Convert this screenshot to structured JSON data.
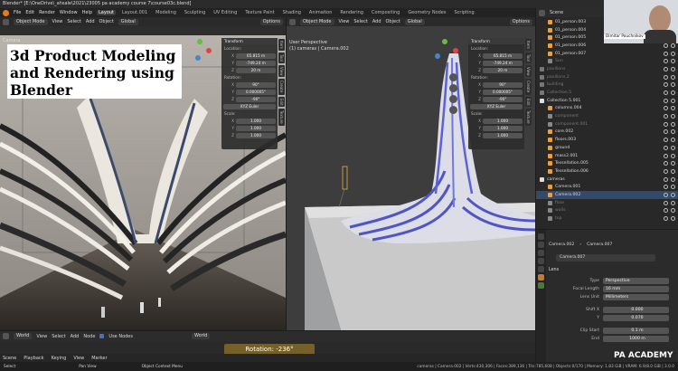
{
  "titlebar": {
    "text": "Blender* [E:\\OneDrive\\_ahsale\\2021\\23005 pa academy course 7\\course03c.blend]"
  },
  "menu": {
    "items": [
      "File",
      "Edit",
      "Render",
      "Window",
      "Help"
    ]
  },
  "workspaces": [
    "Layout",
    "Layout.001",
    "Modeling",
    "Sculpting",
    "UV Editing",
    "Texture Paint",
    "Shading",
    "Animation",
    "Rendering",
    "Compositing",
    "Geometry Nodes",
    "Scripting"
  ],
  "left_view": {
    "header": {
      "mode": "Object Mode",
      "menus": [
        "View",
        "Select",
        "Add",
        "Object"
      ],
      "orientation": "Global",
      "options": "Options"
    },
    "camera_label": "Camera",
    "overlay_title": "3d Product Modeling and Rendering using Blender",
    "npanel": {
      "title": "Transform",
      "location_label": "Location:",
      "location": [
        "65.815 m",
        "-749.24 m",
        "20 m"
      ],
      "rotation_label": "Rotation:",
      "rotation": [
        "90°",
        "0.000005°",
        "-90°"
      ],
      "rotation_mode": "XYZ Euler",
      "scale_label": "Scale:",
      "scale": [
        "1.000",
        "1.000",
        "1.000"
      ],
      "axes": [
        "X",
        "Y",
        "Z"
      ]
    },
    "tabs": [
      "Item",
      "Tool",
      "View",
      "Create",
      "Edit",
      "Texture"
    ]
  },
  "right_view": {
    "header": {
      "mode": "Object Mode",
      "menus": [
        "View",
        "Select",
        "Add",
        "Object"
      ],
      "orientation": "Global",
      "options": "Options"
    },
    "perspective": "User Perspective",
    "collection": "(1) cameras | Camera.002",
    "npanel": {
      "title": "Transform",
      "location_label": "Location:",
      "location": [
        "65.815 m",
        "-749.24 m",
        "20 m"
      ],
      "rotation_label": "Rotation:",
      "rotation": [
        "90°",
        "0.000005°",
        "-90°"
      ],
      "rotation_mode": "XYZ Euler",
      "scale_label": "Scale:",
      "scale": [
        "1.000",
        "1.000",
        "1.000"
      ],
      "axes": [
        "X",
        "Y",
        "Z"
      ]
    },
    "tabs": [
      "Item",
      "Tool",
      "View",
      "Create",
      "Edit",
      "Texture"
    ]
  },
  "node_editor": {
    "type": "World",
    "menus": [
      "View",
      "Select",
      "Add",
      "Node"
    ],
    "use_nodes": "Use Nodes",
    "world": "World",
    "rotation_hud": "Rotation: -236°"
  },
  "timeline": {
    "scene": "Scene",
    "playback": "Playback",
    "keying": "Keying",
    "view": "View",
    "marker": "Marker"
  },
  "statusbar": {
    "left": "Select",
    "mid": "Pan View",
    "menu": "Object Context Menu",
    "right": "cameras | Camera.002 | Verts:430,306 | Faces:389,136 | Tris:785,608 | Objects:0/170 | Memory: 1.83 GiB | VRAM: 6.9/8.0 GiB | 3.0.0"
  },
  "outliner": {
    "scene_label": "Scene",
    "rows": [
      {
        "name": "01_person.003",
        "color": "#e8a040",
        "indent": 1
      },
      {
        "name": "01_person.004",
        "color": "#e8a040",
        "indent": 1
      },
      {
        "name": "01_person.005",
        "color": "#e8a040",
        "indent": 1
      },
      {
        "name": "01_person.006",
        "color": "#e8a040",
        "indent": 1
      },
      {
        "name": "01_person.007",
        "color": "#e8a040",
        "indent": 1
      },
      {
        "name": "Sun",
        "color": "#888",
        "indent": 1,
        "dim": true
      },
      {
        "name": "pavilions",
        "color": "#777",
        "indent": 0,
        "dim": true
      },
      {
        "name": "pavilions.2",
        "color": "#777",
        "indent": 0,
        "dim": true
      },
      {
        "name": "building",
        "color": "#777",
        "indent": 0,
        "dim": true
      },
      {
        "name": "Collection.5",
        "color": "#777",
        "indent": 0,
        "dim": true
      },
      {
        "name": "Collection 5.001",
        "color": "#ddd",
        "indent": 0
      },
      {
        "name": "columns.004",
        "color": "#e8a040",
        "indent": 1
      },
      {
        "name": "component",
        "color": "#888",
        "indent": 1,
        "dim": true
      },
      {
        "name": "component.001",
        "color": "#888",
        "indent": 1,
        "dim": true
      },
      {
        "name": "core.002",
        "color": "#e8a040",
        "indent": 1
      },
      {
        "name": "floors.003",
        "color": "#e8a040",
        "indent": 1
      },
      {
        "name": "ground",
        "color": "#e8a040",
        "indent": 1
      },
      {
        "name": "mass2.001",
        "color": "#e8a040",
        "indent": 1
      },
      {
        "name": "Tessellation.005",
        "color": "#e8a040",
        "indent": 1
      },
      {
        "name": "Tessellation.006",
        "color": "#e8a040",
        "indent": 1
      },
      {
        "name": "cameras",
        "color": "#ddd",
        "indent": 0
      },
      {
        "name": "Camera.001",
        "color": "#e8a040",
        "indent": 1
      },
      {
        "name": "Camera.002",
        "color": "#e8a040",
        "indent": 1
      },
      {
        "name": "floor",
        "color": "#888",
        "indent": 1,
        "dim": true
      },
      {
        "name": "walls",
        "color": "#888",
        "indent": 1,
        "dim": true
      },
      {
        "name": "top",
        "color": "#888",
        "indent": 1,
        "dim": true
      }
    ]
  },
  "webcam": {
    "name": "Dimitar Pouchnikov"
  },
  "properties": {
    "breadcrumb": [
      "Camera.002",
      "Camera.007"
    ],
    "data_name": "Camera.007",
    "lens_section": "Lens",
    "fields": [
      {
        "label": "Type",
        "value": "Perspective"
      },
      {
        "label": "Focal Length",
        "value": "16 mm"
      },
      {
        "label": "Lens Unit",
        "value": "Millimeters"
      },
      {
        "label": "Shift X",
        "value": "0.000"
      },
      {
        "label": "Y",
        "value": "0.070"
      },
      {
        "label": "Clip Start",
        "value": "0.1 m"
      },
      {
        "label": "End",
        "value": "1000 m"
      }
    ]
  },
  "watermark": "PA ACADEMY",
  "colors": {
    "accent": "#4772b3",
    "object": "#e8a040",
    "selected": "#ffaf29"
  }
}
